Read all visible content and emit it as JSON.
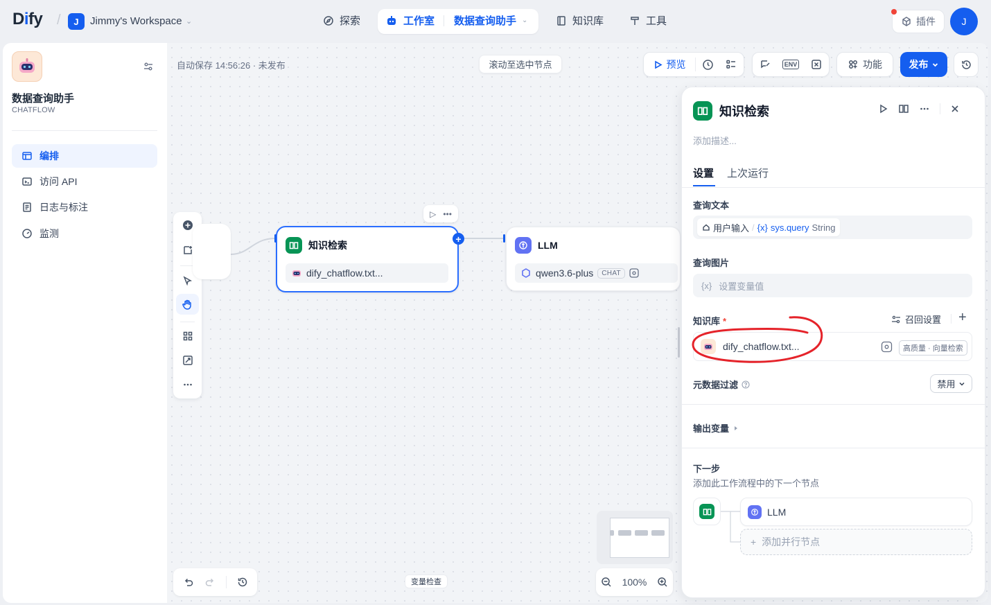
{
  "brand": {
    "logo_text_a": "D",
    "logo_text_b": "i",
    "logo_text_c": "fy"
  },
  "workspace": {
    "initial": "J",
    "name": "Jimmy's Workspace"
  },
  "nav": {
    "explore": "探索",
    "studio": "工作室",
    "app_selector": "数据查询助手",
    "knowledge": "知识库",
    "tools": "工具",
    "plugins": "插件"
  },
  "user": {
    "initial": "J"
  },
  "sidebar": {
    "app_name": "数据查询助手",
    "app_mode": "CHATFLOW",
    "items": [
      {
        "label": "编排",
        "icon": "layout-icon"
      },
      {
        "label": "访问 API",
        "icon": "terminal-icon"
      },
      {
        "label": "日志与标注",
        "icon": "log-icon"
      },
      {
        "label": "监测",
        "icon": "monitor-icon"
      }
    ]
  },
  "canvas": {
    "autosave": "自动保存 14:56:26 · 未发布",
    "scroll_to_node": "滚动至选中节点",
    "var_inspect": "变量检查",
    "zoom": "100%"
  },
  "toolbar": {
    "preview": "预览",
    "env": "ENV",
    "features": "功能",
    "publish": "发布"
  },
  "nodes": {
    "kr": {
      "title": "知识检索",
      "dataset": "dify_chatflow.txt..."
    },
    "llm": {
      "title": "LLM",
      "model": "qwen3.6-plus",
      "mode": "CHAT"
    }
  },
  "panel": {
    "title": "知识检索",
    "desc_placeholder": "添加描述...",
    "tabs": [
      "设置",
      "上次运行"
    ],
    "query_text_label": "查询文本",
    "query_source": "用户输入",
    "query_sep": "/",
    "query_var_prefix": "{x}",
    "query_var": "sys.query",
    "query_type": "String",
    "query_image_label": "查询图片",
    "query_image_placeholder": "设置变量值",
    "query_image_prefix": "{x}",
    "kb_label": "知识库",
    "kb_required": "*",
    "recall_settings": "召回设置",
    "kb_item_name": "dify_chatflow.txt...",
    "kb_item_tag": "高质量 · 向量检索",
    "metadata_filter_label": "元数据过滤",
    "metadata_filter_value": "禁用",
    "output_vars_label": "输出变量",
    "next_step_label": "下一步",
    "next_step_desc": "添加此工作流程中的下一个节点",
    "next_node": "LLM",
    "add_parallel": "添加并行节点"
  },
  "colors": {
    "primary": "#155eef",
    "kr_green": "#079455",
    "llm_purple": "#6172f3",
    "annotation_red": "#e5232a"
  }
}
